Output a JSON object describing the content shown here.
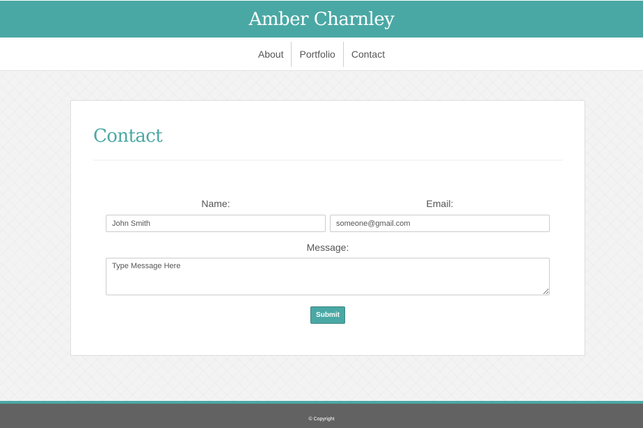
{
  "header": {
    "title": "Amber Charnley"
  },
  "nav": {
    "items": [
      "About",
      "Portfolio",
      "Contact"
    ]
  },
  "contact": {
    "heading": "Contact",
    "name_label": "Name:",
    "email_label": "Email:",
    "message_label": "Message:",
    "name_value": "John Smith",
    "email_value": "someone@gmail.com",
    "message_placeholder": "Type Message Here",
    "submit_label": "Submit"
  },
  "footer": {
    "text": "© Copyright"
  },
  "colors": {
    "accent": "#4aa8a4",
    "footer": "#626262"
  }
}
